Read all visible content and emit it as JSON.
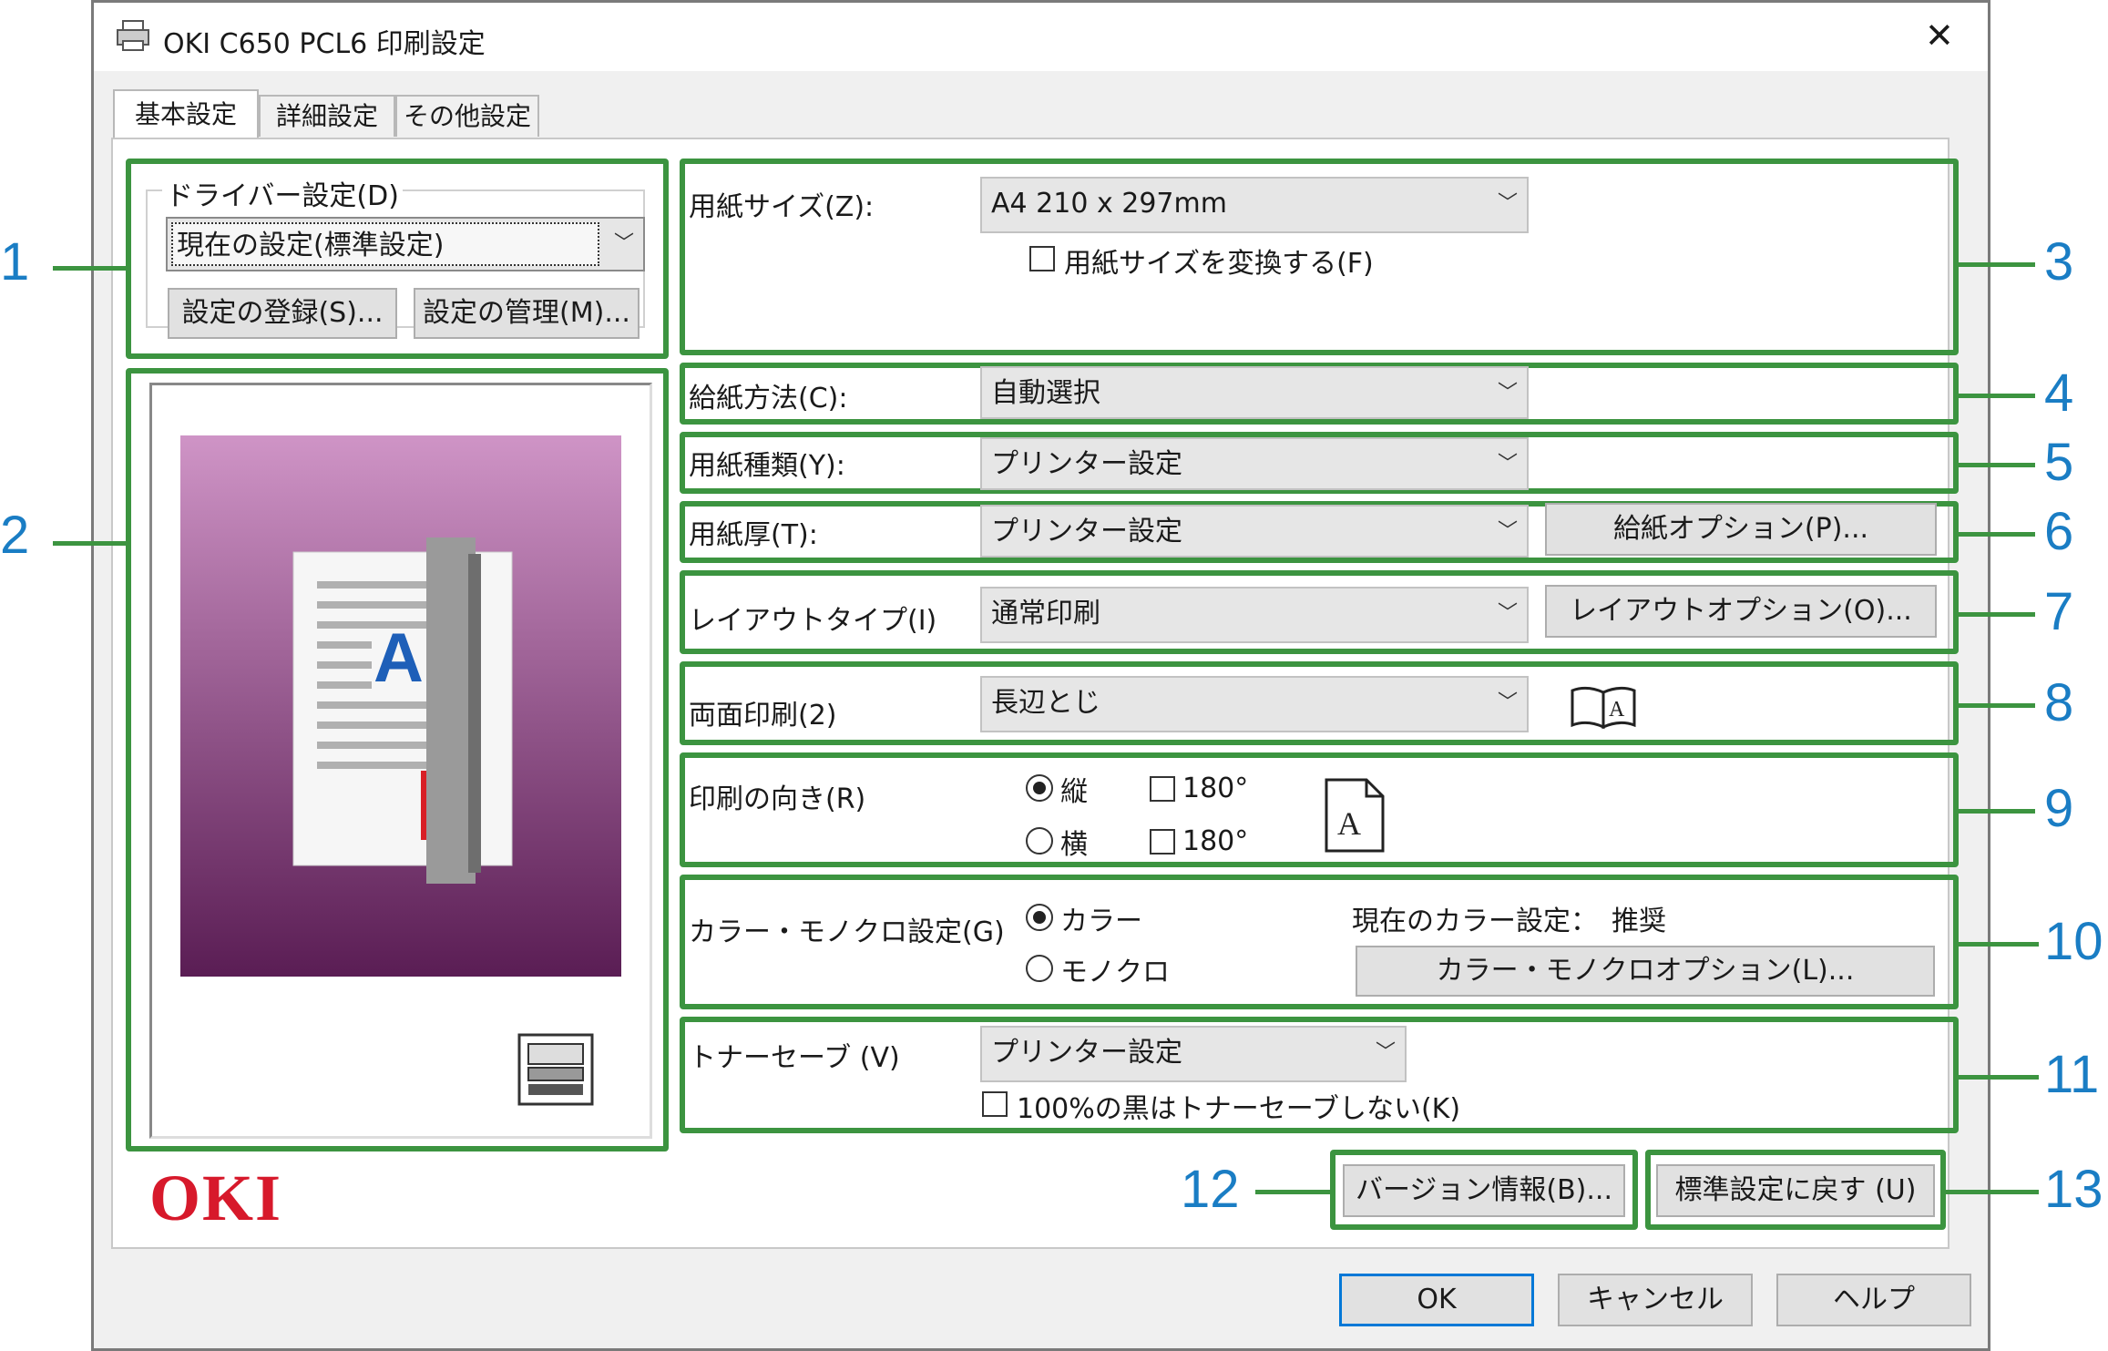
{
  "window": {
    "title": "OKI C650 PCL6 印刷設定",
    "close_glyph": "✕"
  },
  "tabs": [
    {
      "label": "基本設定"
    },
    {
      "label": "詳細設定"
    },
    {
      "label": "その他設定"
    }
  ],
  "driver_settings": {
    "group_label": "ドライバー設定(D)",
    "current_value": "現在の設定(標準設定)",
    "register_button": "設定の登録(S)...",
    "manage_button": "設定の管理(M)..."
  },
  "paper_size": {
    "label": "用紙サイズ(Z):",
    "value": "A4 210 x 297mm",
    "convert_checkbox": "用紙サイズを変換する(F)"
  },
  "paper_source": {
    "label": "給紙方法(C):",
    "value": "自動選択"
  },
  "media_type": {
    "label": "用紙種類(Y):",
    "value": "プリンター設定"
  },
  "media_weight": {
    "label": "用紙厚(T):",
    "value": "プリンター設定",
    "option_button": "給紙オプション(P)..."
  },
  "layout": {
    "label": "レイアウトタイプ(I)",
    "value": "通常印刷",
    "option_button": "レイアウトオプション(O)..."
  },
  "duplex": {
    "label": "両面印刷(2)",
    "value": "長辺とじ"
  },
  "orientation": {
    "label": "印刷の向き(R)",
    "portrait": "縦",
    "landscape": "横",
    "rotate_portrait": "180°",
    "rotate_landscape": "180°",
    "selected": "portrait"
  },
  "color_mode": {
    "label": "カラー・モノクロ設定(G)",
    "color": "カラー",
    "mono": "モノクロ",
    "selected": "color",
    "current_setting": "現在のカラー設定：　推奨",
    "option_button": "カラー・モノクロオプション(L)..."
  },
  "toner_save": {
    "label": "トナーセーブ (V)",
    "value": "プリンター設定",
    "black_checkbox": "100%の黒はトナーセーブしない(K)"
  },
  "bottom_buttons": {
    "version": "バージョン情報(B)...",
    "defaults": "標準設定に戻す (U)"
  },
  "dialog_buttons": {
    "ok": "OK",
    "cancel": "キャンセル",
    "help": "ヘルプ"
  },
  "brand_logo": "OKI",
  "callouts": [
    "1",
    "2",
    "3",
    "4",
    "5",
    "6",
    "7",
    "8",
    "9",
    "10",
    "11",
    "12",
    "13"
  ],
  "colors": {
    "highlight": "#3c9440",
    "callout": "#1a7dc4",
    "logo": "#d7192b",
    "preview_top": "#cf94c6",
    "preview_bottom": "#5a1d54"
  }
}
